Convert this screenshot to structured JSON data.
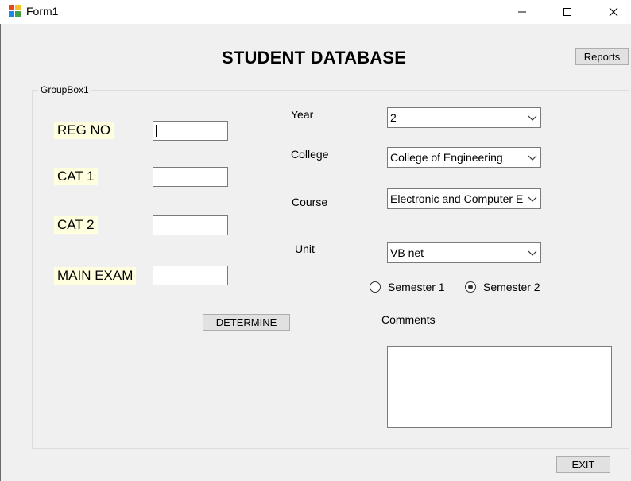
{
  "window": {
    "title": "Form1",
    "icon": "windows-form-icon",
    "controls": [
      "minimize-icon",
      "maximize-icon",
      "close-icon"
    ]
  },
  "form": {
    "heading": "STUDENT DATABASE",
    "reports_label": "Reports",
    "exit_label": "EXIT",
    "groupbox_caption": "GroupBox1"
  },
  "left_fields": {
    "reg_no_label": "REG NO",
    "reg_no_value": "",
    "cat1_label": "CAT 1",
    "cat1_value": "",
    "cat2_label": "CAT 2",
    "cat2_value": "",
    "main_exam_label": "MAIN EXAM",
    "main_exam_value": "",
    "determine_label": "DETERMINE"
  },
  "right_fields": {
    "year_label": "Year",
    "year_value": "2",
    "college_label": "College",
    "college_value": "College of Engineering",
    "course_label": "Course",
    "course_value": "Electronic and Computer En",
    "unit_label": "Unit",
    "unit_value": "VB net",
    "semester1_label": "Semester 1",
    "semester2_label": "Semester 2",
    "selected_semester": "Semester 2",
    "comments_label": "Comments",
    "comments_value": ""
  },
  "colors": {
    "label_highlight": "#ffffe0",
    "button_face": "#e1e1e1",
    "form_background": "#f0f0f0"
  }
}
